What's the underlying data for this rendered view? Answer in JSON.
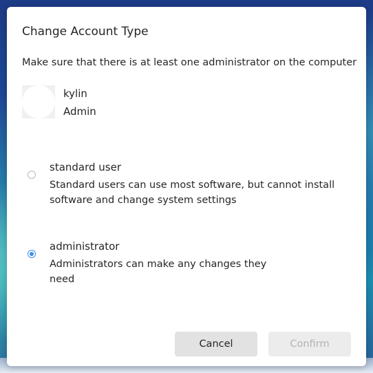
{
  "dialog": {
    "title": "Change Account Type",
    "hint": "Make sure that there is at least one administrator on the computer"
  },
  "user": {
    "name": "kylin",
    "type": "Admin"
  },
  "options": [
    {
      "label": "standard user",
      "desc_line1": "Standard users can use most software, but cannot install",
      "desc_line2": "software and change system settings",
      "selected": false
    },
    {
      "label": "administrator",
      "desc_line1": "Administrators can make any changes they",
      "desc_line2": "need",
      "selected": true
    }
  ],
  "buttons": {
    "cancel": "Cancel",
    "confirm": "Confirm",
    "confirm_enabled": false
  },
  "colors": {
    "accent": "#3e8ee8",
    "cancel_bg": "#e2e2e2",
    "confirm_bg": "#ececec",
    "confirm_text_disabled": "#b3b3b3"
  }
}
